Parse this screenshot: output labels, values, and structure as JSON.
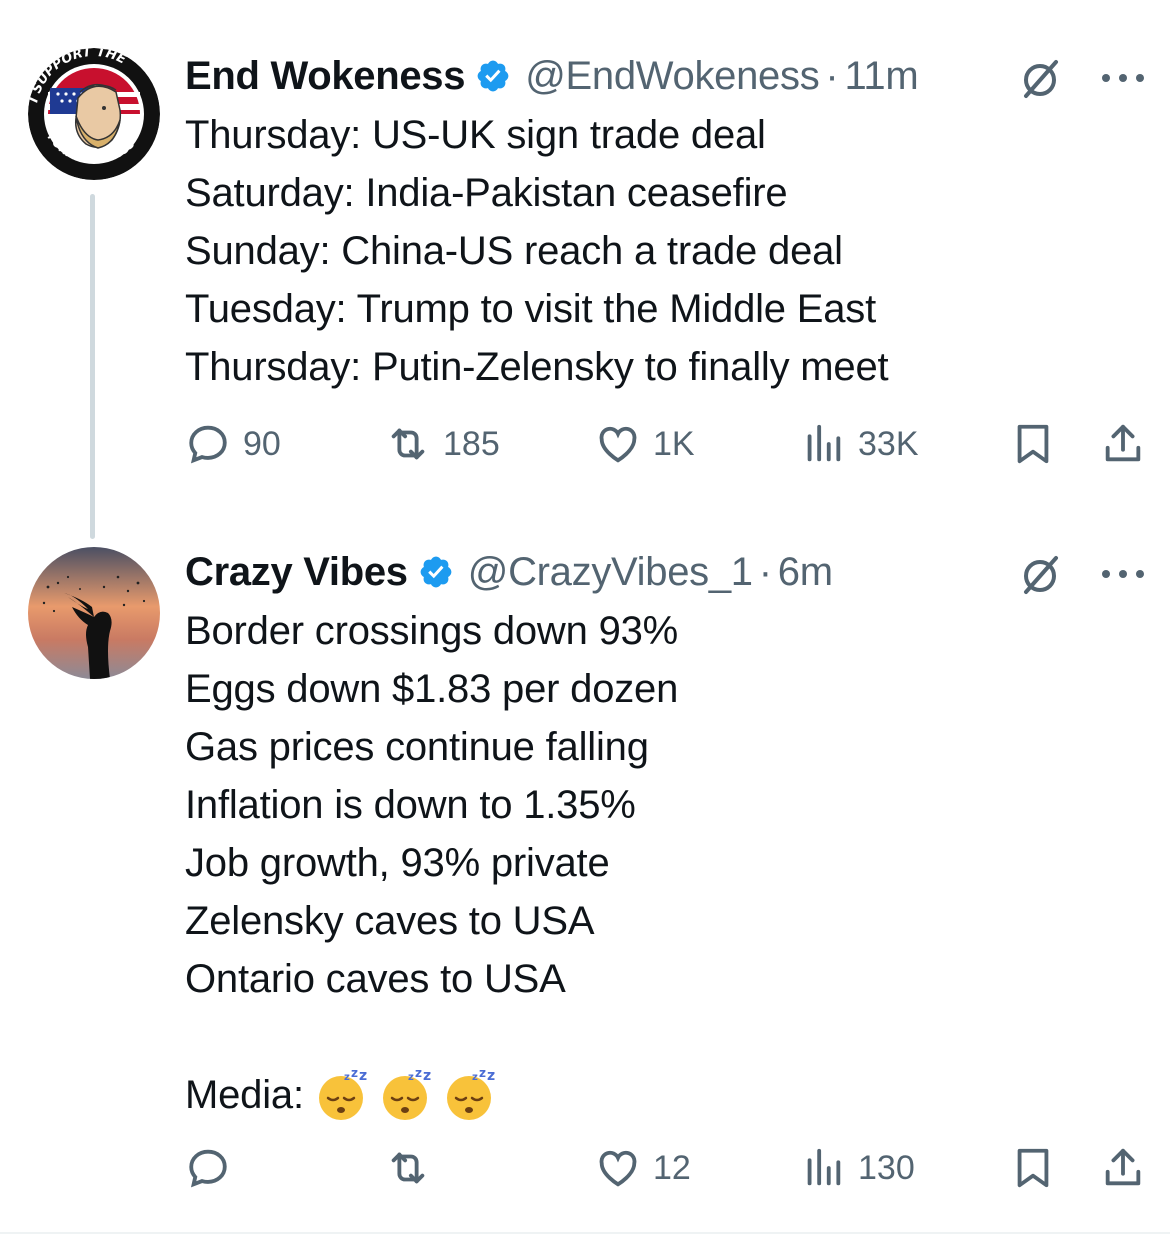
{
  "tweets": [
    {
      "author": {
        "name": "End Wokeness",
        "handle": "@EndWokeness",
        "verified": true,
        "avatar_text_top": "I SUPPORT THE",
        "avatar_text_bottom": "FORMER THINGS"
      },
      "time": "11m",
      "separator": "·",
      "lines": [
        "Thursday: US-UK sign trade deal",
        "Saturday: India-Pakistan ceasefire",
        "Sunday: China-US reach a trade deal",
        "Tuesday: Trump to visit the Middle East",
        "Thursday: Putin-Zelensky to finally meet"
      ],
      "metrics": {
        "replies": "90",
        "reposts": "185",
        "likes": "1K",
        "views": "33K"
      }
    },
    {
      "author": {
        "name": "Crazy Vibes",
        "handle": "@CrazyVibes_1",
        "verified": true
      },
      "time": "6m",
      "separator": "·",
      "lines": [
        "Border crossings down 93%",
        "Eggs down $1.83 per dozen",
        "Gas prices continue falling",
        "Inflation is down to 1.35%",
        "Job growth, 93% private",
        "Zelensky caves to USA",
        "Ontario caves to USA"
      ],
      "media_label": "Media:",
      "media_emojis": [
        "sleeping-face",
        "sleeping-face",
        "sleeping-face"
      ],
      "metrics": {
        "replies": "",
        "reposts": "",
        "likes": "12",
        "views": "130"
      }
    }
  ],
  "colors": {
    "text": "#0f1419",
    "secondary": "#536471",
    "verified": "#1d9bf0",
    "thread_line": "#cfd9de"
  },
  "icons": [
    "grok-icon",
    "more-icon",
    "reply-icon",
    "repost-icon",
    "like-icon",
    "views-icon",
    "bookmark-icon",
    "share-icon",
    "verified-icon"
  ]
}
